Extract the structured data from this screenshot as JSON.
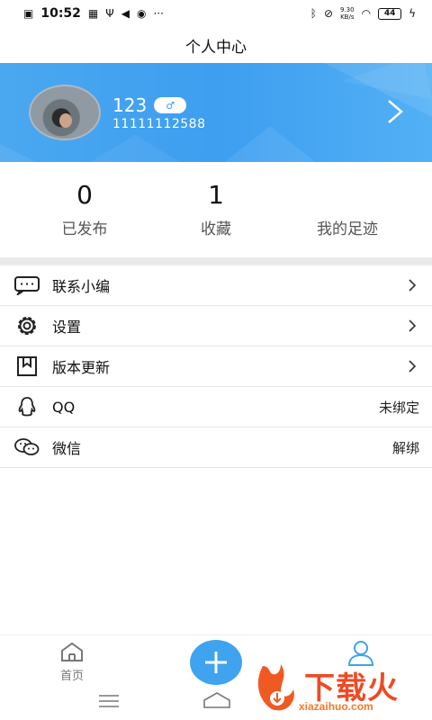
{
  "status_bar": {
    "time": "10:52",
    "net_speed_value": "9.30",
    "net_speed_unit": "KB/s",
    "battery": "44"
  },
  "header": {
    "title": "个人中心"
  },
  "profile": {
    "name": "123",
    "phone": "11111112588",
    "gender_icon": "male-symbol",
    "accent": "#3e9ef0"
  },
  "stats": [
    {
      "value": "0",
      "label": "已发布"
    },
    {
      "value": "1",
      "label": "收藏"
    },
    {
      "value": "",
      "label": "我的足迹"
    }
  ],
  "menu": [
    {
      "label": "联系小编",
      "icon": "chat-bubble-icon",
      "value": "",
      "arrow": true
    },
    {
      "label": "设置",
      "icon": "gear-icon",
      "value": "",
      "arrow": true
    },
    {
      "label": "版本更新",
      "icon": "bookmark-icon",
      "value": "",
      "arrow": true
    },
    {
      "label": "QQ",
      "icon": "qq-icon",
      "value": "未绑定",
      "arrow": false
    },
    {
      "label": "微信",
      "icon": "wechat-icon",
      "value": "解绑",
      "arrow": false
    }
  ],
  "bottom_nav": {
    "home_label": "首页"
  },
  "watermark": {
    "title": "下载火",
    "url": "xiazaihuo.com"
  }
}
